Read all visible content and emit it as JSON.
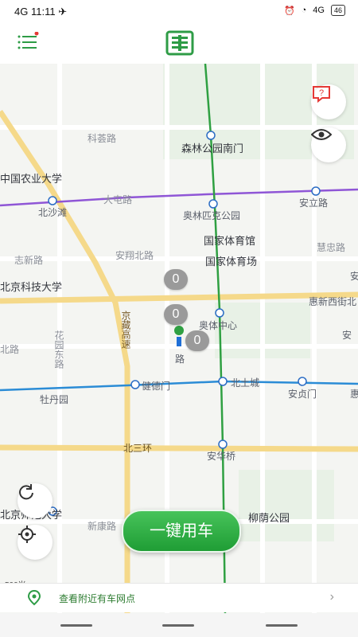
{
  "status": {
    "network": "4G",
    "time": "11:11",
    "signal": "4G",
    "battery": "46"
  },
  "app": {
    "logo_text": "嘉"
  },
  "map": {
    "labels": {
      "shaxi_road": "科荟路",
      "forest_south": "森林公园南门",
      "ag_uni": "中国农业大学",
      "datun": "大屯路",
      "beishawan": "北沙滩",
      "olympic_park": "奥林匹克公园",
      "anli": "安立路",
      "stadium1": "国家体育馆",
      "stadium2": "国家体育场",
      "zhixin": "志新路",
      "anyuan": "安翔北路",
      "huizhong": "慧忠路",
      "ustb": "北京科技大学",
      "olympic_center": "奥体中心",
      "huixin_west": "惠新西街北",
      "jingzang": "京藏高速",
      "north_road": "北路",
      "huayuan": "花园东路",
      "jiande": "健德门",
      "beitucheng": "北土城",
      "anzhen": "安贞门",
      "mudanyuan": "牡丹园",
      "north3": "北三环",
      "anhuaqiao": "安华桥",
      "liuyin": "柳荫公园",
      "bjfu": "北京师范大学",
      "xinkang": "新康路",
      "lu": "路",
      "an_a": "安",
      "an_b": "安",
      "hui": "惠"
    },
    "cluster_counts": [
      "0",
      "0",
      "0"
    ],
    "scale_label": "500米"
  },
  "cta": {
    "label": "一键用车"
  },
  "bottombar": {
    "text": "查看附近有车网点",
    "chevron": "›"
  },
  "icons": {
    "help": "help-icon",
    "eye": "eye-icon",
    "refresh": "refresh-icon",
    "locate": "locate-icon"
  }
}
